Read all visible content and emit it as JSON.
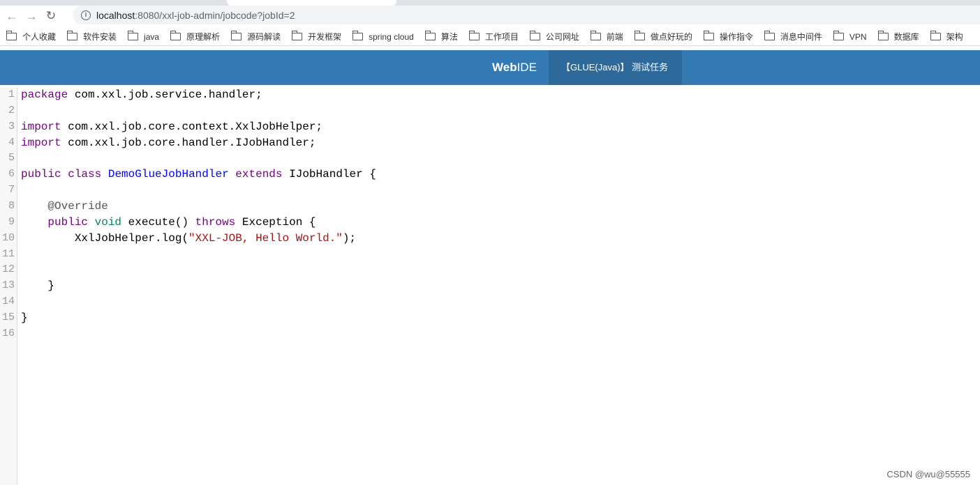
{
  "browser": {
    "url_host": "localhost",
    "url_path": ":8080/xxl-job-admin/jobcode?jobId=2",
    "bookmarks": [
      "个人收藏",
      "软件安装",
      "java",
      "原理解析",
      "源码解读",
      "开发框架",
      "spring cloud",
      "算法",
      "工作项目",
      "公司网址",
      "前端",
      "做点好玩的",
      "操作指令",
      "消息中间件",
      "VPN",
      "数据库",
      "架构"
    ]
  },
  "header": {
    "brand_bold": "Web",
    "brand_rest": "IDE",
    "job_tab": "【GLUE(Java)】 测试任务",
    "color": "#3379b3"
  },
  "editor": {
    "lines": [
      [
        [
          "kw",
          "package"
        ],
        [
          "",
          "com.xxl.job.service.handler;"
        ]
      ],
      [],
      [
        [
          "kw",
          "import"
        ],
        [
          "",
          "com.xxl.job.core.context.XxlJobHelper;"
        ]
      ],
      [
        [
          "kw",
          "import"
        ],
        [
          "",
          "com.xxl.job.core.handler.IJobHandler;"
        ]
      ],
      [],
      [
        [
          "kw",
          "public"
        ],
        [
          "kw",
          "class"
        ],
        [
          "def",
          "DemoGlueJobHandler"
        ],
        [
          "kw",
          "extends"
        ],
        [
          "",
          "IJobHandler {"
        ]
      ],
      [],
      [
        [
          "meta",
          "    @Override"
        ]
      ],
      [
        [
          "kw",
          "    public"
        ],
        [
          "ty",
          "void"
        ],
        [
          "",
          "execute()"
        ],
        [
          "kw",
          "throws"
        ],
        [
          "",
          "Exception {"
        ]
      ],
      [
        [
          "",
          "        XxlJobHelper.log("
        ],
        [
          "str",
          "\"XXL-JOB, Hello World.\""
        ],
        [
          "",
          ");"
        ]
      ],
      [],
      [],
      [
        [
          "",
          "    }"
        ]
      ],
      [],
      [
        [
          "",
          "}"
        ]
      ],
      []
    ]
  },
  "watermark": "CSDN @wu@55555"
}
